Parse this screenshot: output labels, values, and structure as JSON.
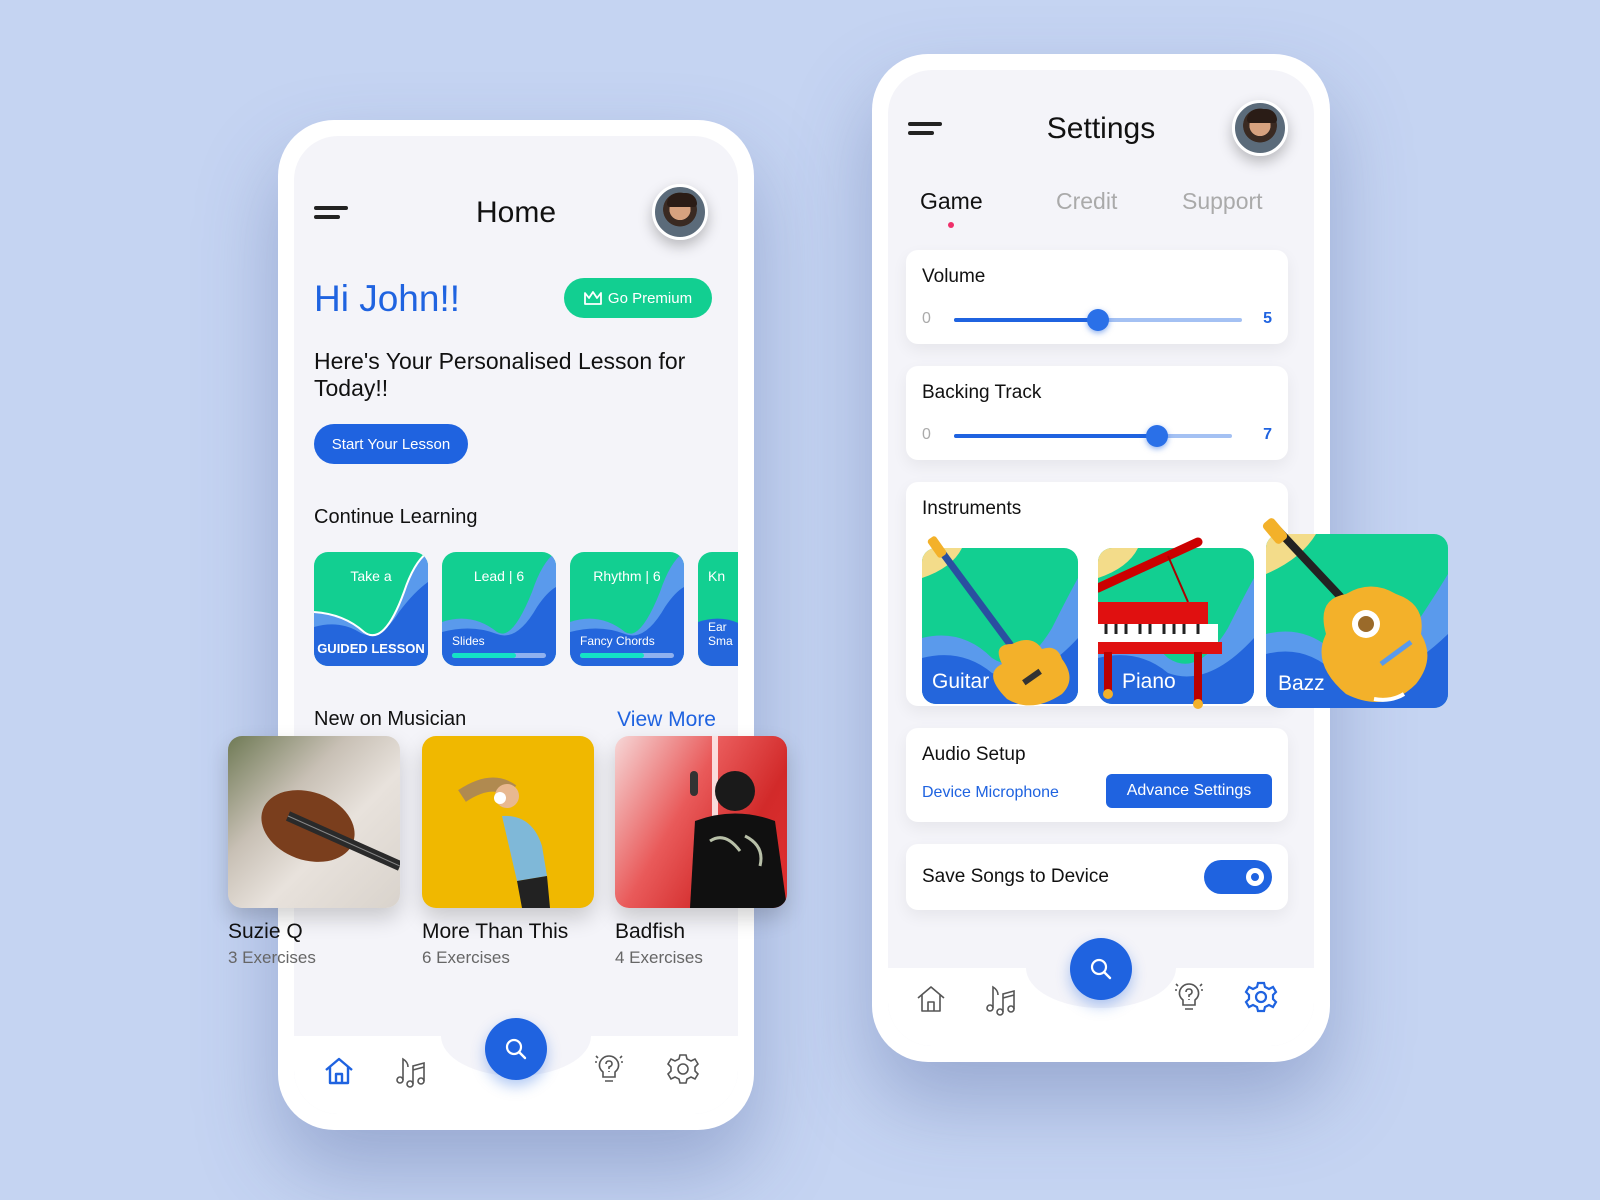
{
  "home": {
    "title": "Home",
    "greeting": "Hi John!!",
    "premium_label": "Go Premium",
    "lesson_heading": "Here's Your Personalised Lesson for Today!!",
    "start_label": "Start Your Lesson",
    "continue_heading": "Continue Learning",
    "cards": [
      {
        "top": "Take a",
        "bottom": "GUIDED LESSON"
      },
      {
        "top": "Lead | 6",
        "bottom": "Slides",
        "progress": 0.68
      },
      {
        "top": "Rhythm | 6",
        "bottom": "Fancy Chords",
        "progress": 0.68
      },
      {
        "top": "Kn",
        "bottom": "Ear Sma"
      }
    ],
    "new_heading": "New on Musician",
    "view_more": "View More",
    "songs": [
      {
        "title": "Suzie Q",
        "sub": "3 Exercises"
      },
      {
        "title": "More Than This",
        "sub": "6 Exercises"
      },
      {
        "title": "Badfish",
        "sub": "4 Exercises"
      }
    ],
    "nav": [
      "home-icon",
      "music-notes-icon",
      "search-icon",
      "idea-bulb-icon",
      "gear-icon"
    ],
    "nav_active": "home"
  },
  "settings": {
    "title": "Settings",
    "tabs": [
      "Game",
      "Credit",
      "Support"
    ],
    "active_tab": "Game",
    "volume": {
      "label": "Volume",
      "min": "0",
      "max": "5",
      "fraction": 0.5
    },
    "backing": {
      "label": "Backing Track",
      "min": "0",
      "max": "7",
      "fraction": 0.73
    },
    "instruments_heading": "Instruments",
    "instruments": [
      "Guitar",
      "Piano",
      "Bazz"
    ],
    "audio": {
      "label": "Audio Setup",
      "device": "Device Microphone",
      "advance": "Advance Settings"
    },
    "save": {
      "label": "Save Songs to Device",
      "enabled": true
    },
    "nav_active": "settings"
  },
  "colors": {
    "primary": "#1f63e0",
    "green": "#12cf91",
    "background": "#c5d4f2",
    "tab_dot": "#ef2f6a"
  }
}
